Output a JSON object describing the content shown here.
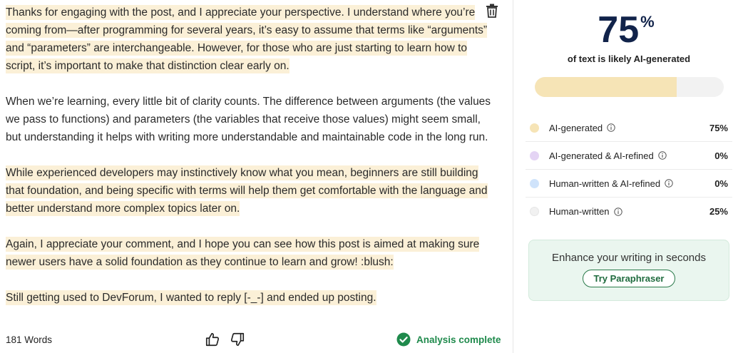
{
  "document": {
    "paragraphs": [
      {
        "segments": [
          {
            "text": "Thanks for engaging with the post, and I appreciate your perspective. I understand where you’re coming from—after programming for several years, it’s easy to assume that terms like “arguments” and “parameters” are interchangeable. However, for those who are just starting to learn how to script, it’s important to make that distinction clear early on.",
            "ai": true
          }
        ]
      },
      {
        "segments": [
          {
            "text": "When we’re learning, every little bit of clarity counts. The difference between arguments (the values we pass to functions) and parameters (the variables that receive those values) might seem small, but understanding it helps with writing more understandable and maintainable code in the long run.",
            "ai": false
          }
        ]
      },
      {
        "segments": [
          {
            "text": "While experienced developers may instinctively know what you mean, beginners are still building that foundation, and being specific with terms will help them get comfortable with the language and better understand more complex topics later on.",
            "ai": true
          }
        ]
      },
      {
        "segments": [
          {
            "text": "Again, I appreciate your comment, and I hope you can see how this post is aimed at making sure newer users have a solid foundation as they continue to learn and grow! :blush:",
            "ai": true
          }
        ]
      },
      {
        "segments": [
          {
            "text": "Still getting used to DevForum, I wanted to reply [-_-] and ended up posting.",
            "ai": true
          }
        ]
      }
    ],
    "highlight_color": "#fbf0d7"
  },
  "footer": {
    "word_count": "181 Words",
    "status": "Analysis complete",
    "status_color": "#1f8a4c"
  },
  "result": {
    "percent": "75",
    "percent_sign": "%",
    "subtitle": "of text is likely AI-generated",
    "ai_fraction": 0.75
  },
  "legend": [
    {
      "label": "AI-generated",
      "value": "75%",
      "color": "#f6e4b6"
    },
    {
      "label": "AI-generated & AI-refined",
      "value": "0%",
      "color": "#e4d4f4"
    },
    {
      "label": "Human-written & AI-refined",
      "value": "0%",
      "color": "#cfe3fb"
    },
    {
      "label": "Human-written",
      "value": "25%",
      "color": "#f1f1f1"
    }
  ],
  "promo": {
    "text": "Enhance your writing in seconds",
    "button_label": "Try Paraphraser"
  },
  "icons": {
    "trash": "trash-icon",
    "thumb_up": "thumbs-up-icon",
    "thumb_down": "thumbs-down-icon",
    "status": "check-circle-icon",
    "info": "info-icon"
  }
}
